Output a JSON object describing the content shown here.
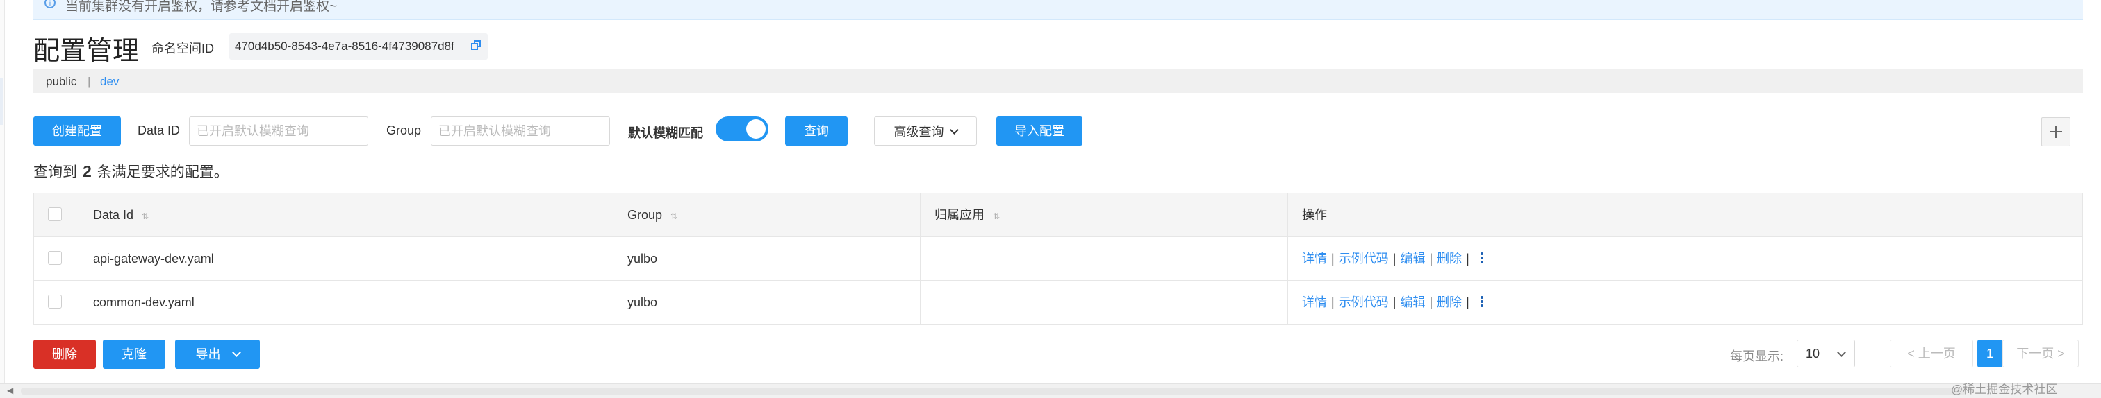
{
  "notice": {
    "icon": "info-circle-icon",
    "text": "当前集群没有开启鉴权，请参考文档开启鉴权~"
  },
  "header": {
    "title": "配置管理",
    "namespace_label": "命名空间ID",
    "namespace_id": "470d4b50-8543-4e7a-8516-4f4739087d8f",
    "copy_icon": "copy-icon"
  },
  "namespaces": {
    "items": [
      "public",
      "dev"
    ],
    "separator": "|",
    "active": "dev"
  },
  "toolbar": {
    "create_label": "创建配置",
    "data_id_label": "Data ID",
    "data_id_placeholder": "已开启默认模糊查询",
    "group_label": "Group",
    "group_placeholder": "已开启默认模糊查询",
    "fuzzy_label": "默认模糊匹配",
    "fuzzy_enabled": true,
    "query_label": "查询",
    "advanced_label": "高级查询",
    "import_label": "导入配置",
    "add_icon": "plus-icon"
  },
  "result": {
    "prefix": "查询到",
    "count": "2",
    "suffix": "条满足要求的配置。"
  },
  "table": {
    "columns": [
      "Data Id",
      "Group",
      "归属应用",
      "操作"
    ],
    "rows": [
      {
        "data_id": "api-gateway-dev.yaml",
        "group": "yulbo",
        "app": ""
      },
      {
        "data_id": "common-dev.yaml",
        "group": "yulbo",
        "app": ""
      }
    ],
    "actions": [
      "详情",
      "示例代码",
      "编辑",
      "删除"
    ],
    "action_sep": "|"
  },
  "bulk": {
    "delete_label": "删除",
    "clone_label": "克隆",
    "export_label": "导出"
  },
  "pagination": {
    "page_size_label": "每页显示:",
    "page_size": "10",
    "prev_label": "< 上一页",
    "current_page": "1",
    "next_label": "下一页 >"
  },
  "watermark": "@稀土掘金技术社区",
  "colors": {
    "primary": "#2196f3",
    "danger": "#d93026",
    "link": "#2f8ef0"
  }
}
